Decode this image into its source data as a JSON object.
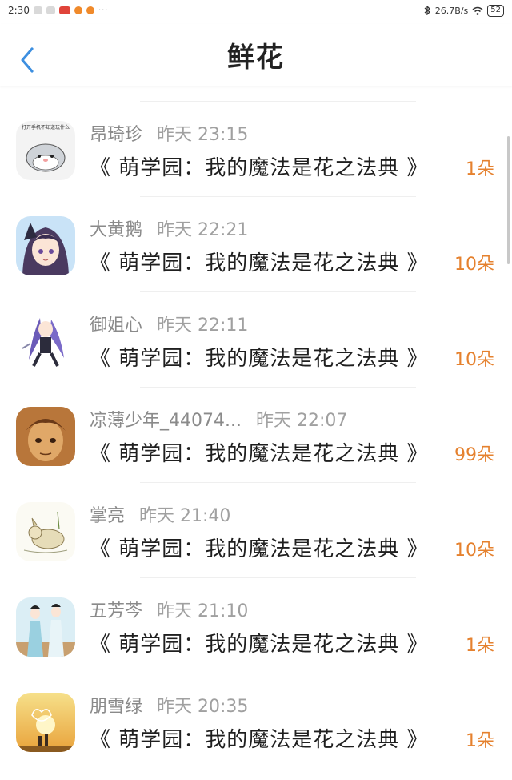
{
  "status_bar": {
    "time": "2:30",
    "dots": "···",
    "net_speed": "26.7B/s",
    "battery": "52"
  },
  "header": {
    "title": "鲜花"
  },
  "colors": {
    "accent_blue": "#3d8fe0",
    "amount_orange": "#e5812e"
  },
  "entries": [
    {
      "name": "昂琦珍",
      "time": "昨天 23:15",
      "book": "《 萌学园：我的魔法是花之法典 》",
      "amount": "1朵",
      "avatar_caption": "打开手机不知道玩什么",
      "avatar_icon": "hamster-avatar-icon"
    },
    {
      "name": "大黄鹅",
      "time": "昨天 22:21",
      "book": "《 萌学园：我的魔法是花之法典 》",
      "amount": "10朵",
      "avatar_icon": "anime-girl-avatar-icon"
    },
    {
      "name": "御姐心",
      "time": "昨天 22:11",
      "book": "《 萌学园：我的魔法是花之法典 》",
      "amount": "10朵",
      "avatar_icon": "anime-purple-hair-avatar-icon"
    },
    {
      "name": "凉薄少年_44074...",
      "time": "昨天 22:07",
      "book": "《 萌学园：我的魔法是花之法典 》",
      "amount": "99朵",
      "avatar_icon": "anime-boy-avatar-icon"
    },
    {
      "name": "掌亮",
      "time": "昨天 21:40",
      "book": "《 萌学园：我的魔法是花之法典 》",
      "amount": "10朵",
      "avatar_icon": "sketch-animal-avatar-icon"
    },
    {
      "name": "五芳芩",
      "time": "昨天 21:10",
      "book": "《 萌学园：我的魔法是花之法典 》",
      "amount": "1朵",
      "avatar_icon": "ancient-couple-avatar-icon"
    },
    {
      "name": "朋雪绿",
      "time": "昨天 20:35",
      "book": "《 萌学园：我的魔法是花之法典 》",
      "amount": "1朵",
      "avatar_icon": "sunset-couple-avatar-icon"
    }
  ]
}
